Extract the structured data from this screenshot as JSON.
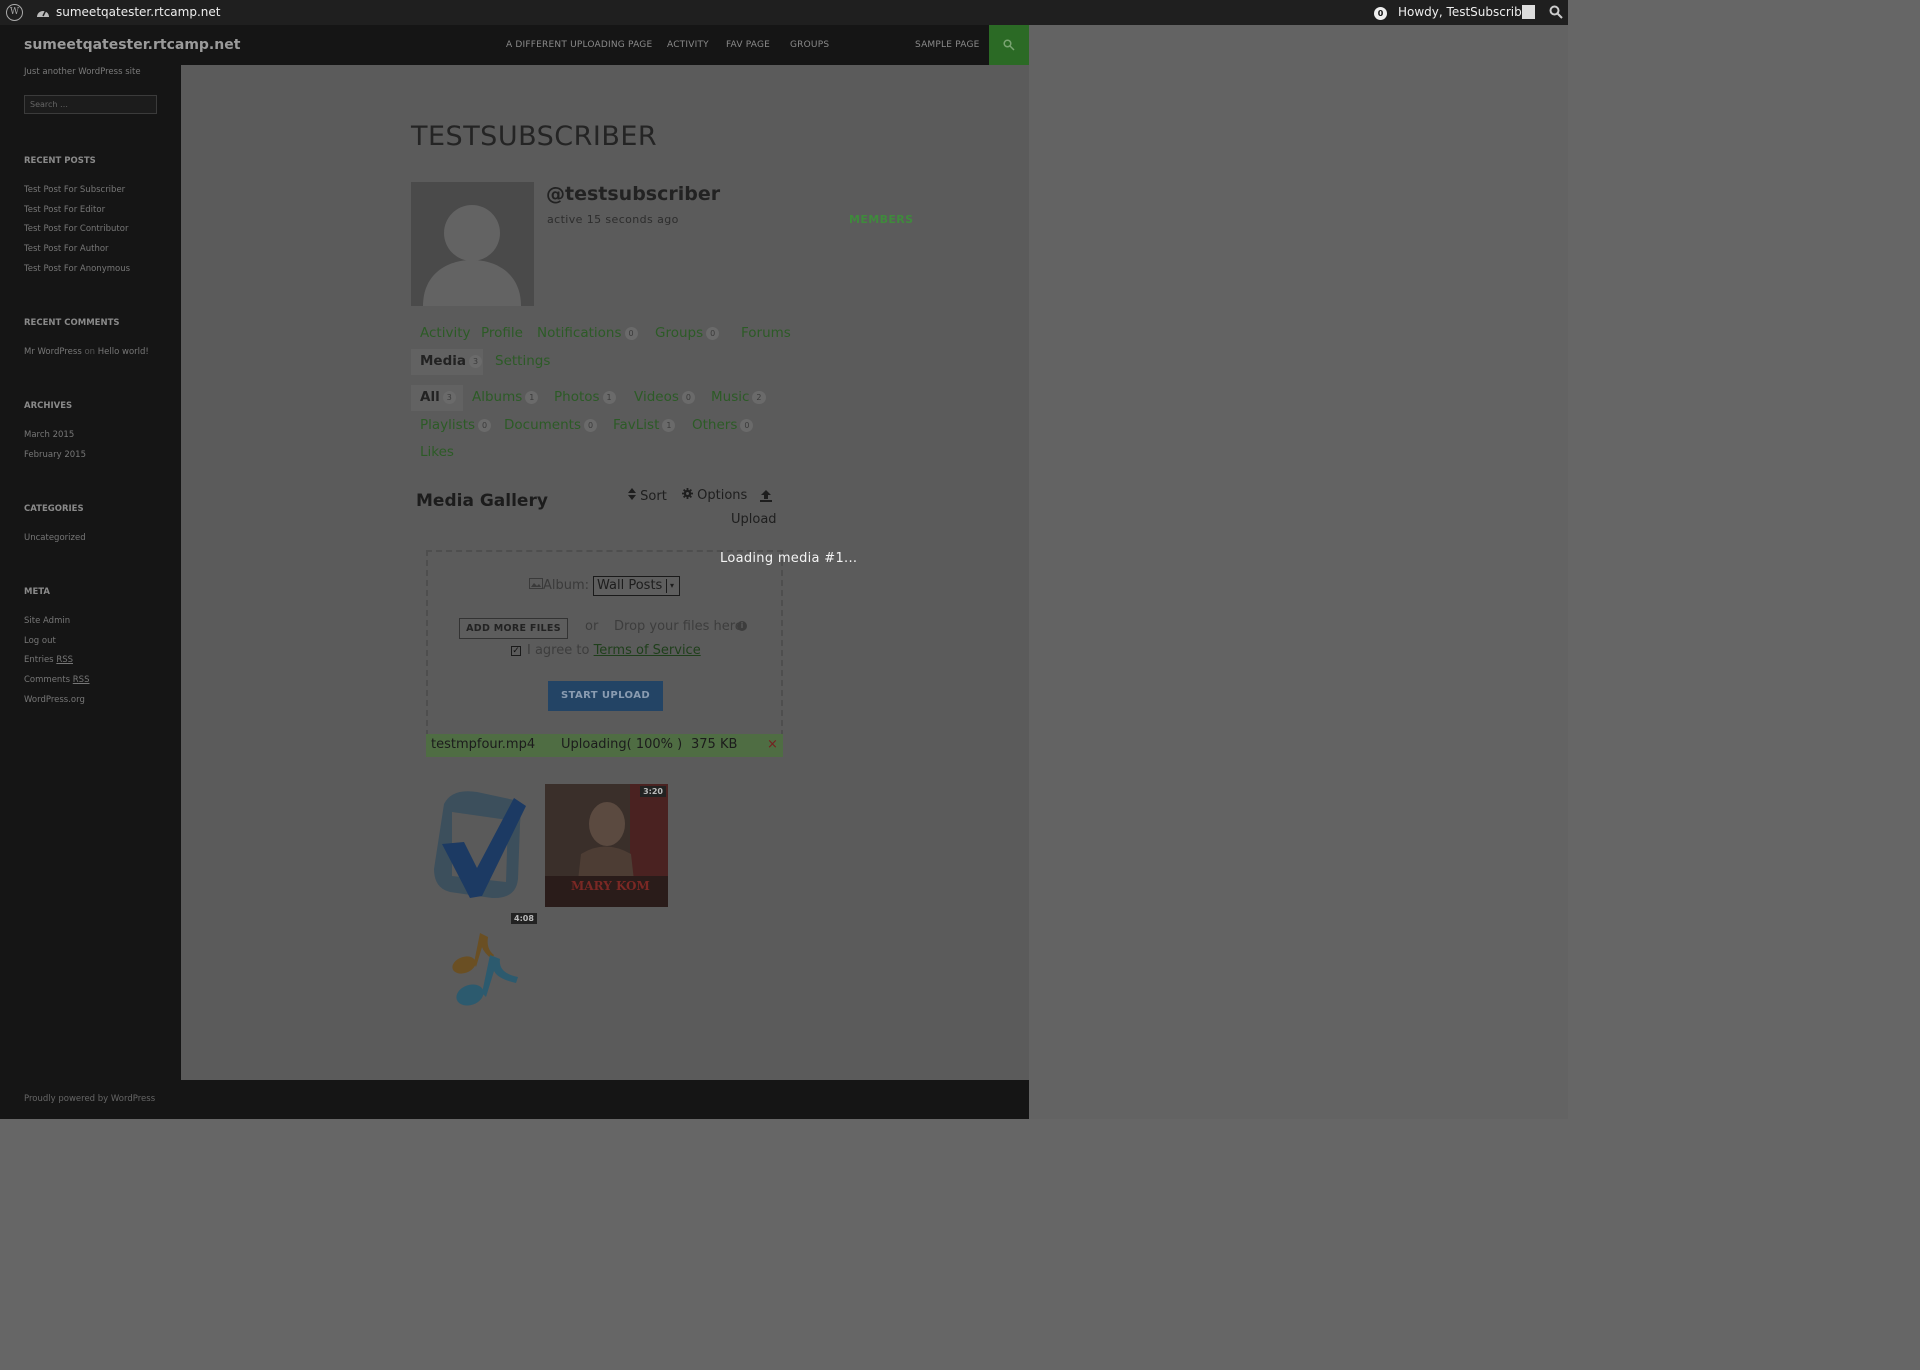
{
  "admin_bar": {
    "site_name": "sumeetqatester.rtcamp.net",
    "notification_count": "0",
    "howdy": "Howdy, TestSubscriber"
  },
  "header": {
    "site_title": "sumeetqatester.rtcamp.net",
    "tagline": "Just another WordPress site",
    "nav": [
      {
        "label": "A DIFFERENT UPLOADING PAGE"
      },
      {
        "label": "ACTIVITY"
      },
      {
        "label": "FAV PAGE"
      },
      {
        "label": "GROUPS"
      },
      {
        "label": "MEMBERS",
        "active": true
      },
      {
        "label": "SAMPLE PAGE"
      }
    ]
  },
  "sidebar": {
    "search_placeholder": "Search …",
    "recent_posts": {
      "heading": "RECENT POSTS",
      "items": [
        "Test Post For Subscriber",
        "Test Post For Editor",
        "Test Post For Contributor",
        "Test Post For Author",
        "Test Post For Anonymous"
      ]
    },
    "recent_comments": {
      "heading": "RECENT COMMENTS",
      "author": "Mr WordPress",
      "on": "on",
      "post": "Hello world!"
    },
    "archives": {
      "heading": "ARCHIVES",
      "items": [
        "March 2015",
        "February 2015"
      ]
    },
    "categories": {
      "heading": "CATEGORIES",
      "items": [
        "Uncategorized"
      ]
    },
    "meta": {
      "heading": "META",
      "items": [
        "Site Admin",
        "Log out",
        "Entries",
        "Comments",
        "WordPress.org"
      ],
      "rss": "RSS"
    }
  },
  "footer": {
    "text": "Proudly powered by WordPress"
  },
  "profile": {
    "title": "TESTSUBSCRIBER",
    "handle": "@testsubscriber",
    "active": "active 15 seconds ago",
    "tabs": [
      {
        "label": "Activity"
      },
      {
        "label": "Profile"
      },
      {
        "label": "Notifications",
        "count": "0"
      },
      {
        "label": "Groups",
        "count": "0"
      },
      {
        "label": "Forums"
      },
      {
        "label": "Media",
        "count": "3",
        "current": true
      },
      {
        "label": "Settings"
      }
    ],
    "media_tabs": [
      {
        "label": "All",
        "count": "3",
        "current": true
      },
      {
        "label": "Albums",
        "count": "1"
      },
      {
        "label": "Photos",
        "count": "1"
      },
      {
        "label": "Videos",
        "count": "0"
      },
      {
        "label": "Music",
        "count": "2"
      },
      {
        "label": "Playlists",
        "count": "0"
      },
      {
        "label": "Documents",
        "count": "0"
      },
      {
        "label": "FavList",
        "count": "1"
      },
      {
        "label": "Others",
        "count": "0"
      },
      {
        "label": "Likes"
      }
    ]
  },
  "gallery": {
    "title": "Media Gallery",
    "sort": "Sort",
    "options": "Options",
    "upload": "Upload",
    "loading": "Loading media #1...",
    "album_label": "Album:",
    "album_value": "Wall Posts",
    "add_more": "ADD MORE FILES",
    "or": "or",
    "drop": "Drop your files here",
    "agree": "I agree to",
    "tos": "Terms of Service",
    "start_upload": "START UPLOAD",
    "upload_row": {
      "file": "testmpfour.mp4",
      "status": "Uploading( 100% )",
      "size": "375 KB",
      "remove": "×"
    },
    "items": [
      {
        "icon": "checkmark-icon",
        "duration": "4:08"
      },
      {
        "icon": "movie-poster",
        "duration": "3:20",
        "poster_text": "MARY KOM"
      },
      {
        "icon": "music-note-icon"
      }
    ]
  },
  "colors": {
    "accent_green": "#2b6a25",
    "start_upload_blue": "#234465",
    "progress_green": "#4f6d43"
  }
}
